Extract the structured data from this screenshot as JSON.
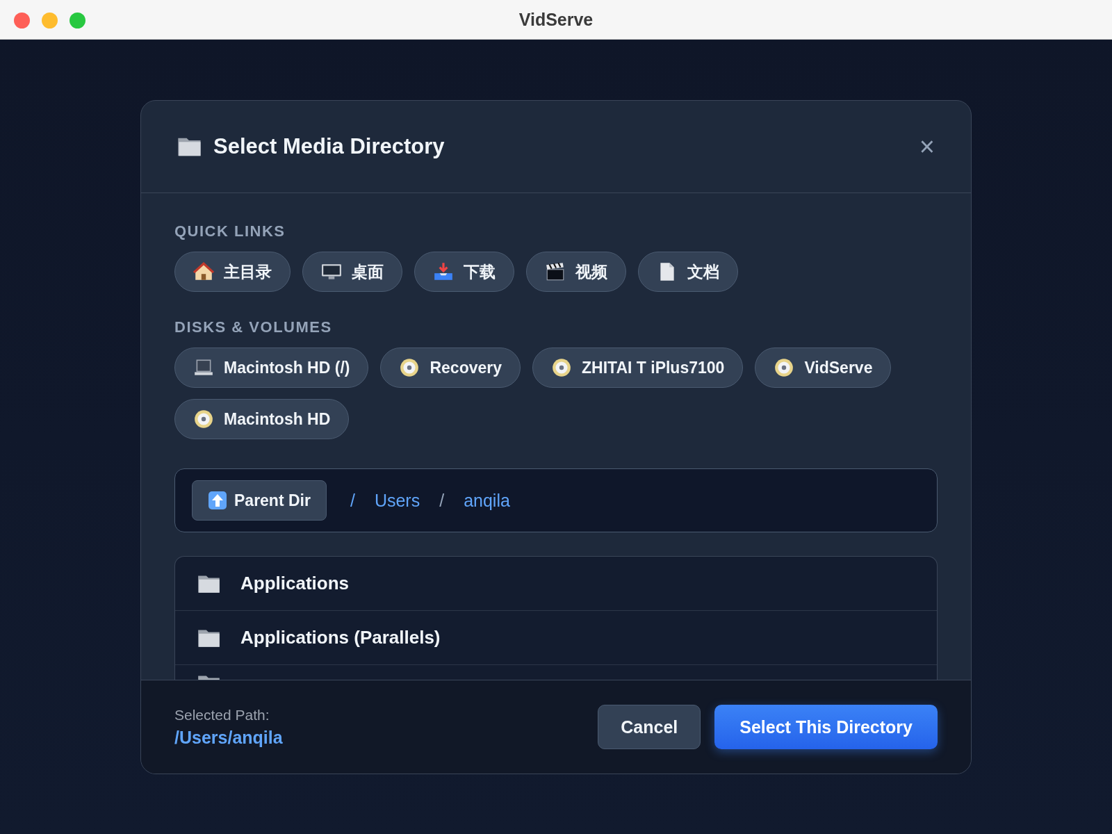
{
  "window": {
    "title": "VidServe"
  },
  "dialog": {
    "title": "Select Media Directory",
    "close": "×"
  },
  "quick_links": {
    "heading": "QUICK LINKS",
    "items": [
      {
        "kind": "home",
        "label": "主目录"
      },
      {
        "kind": "desktop",
        "label": "桌面"
      },
      {
        "kind": "download",
        "label": "下载"
      },
      {
        "kind": "video",
        "label": "视频"
      },
      {
        "kind": "document",
        "label": "文档"
      }
    ]
  },
  "disks": {
    "heading": "DISKS & VOLUMES",
    "items": [
      {
        "kind": "laptop",
        "label": "Macintosh HD (/)"
      },
      {
        "kind": "disc",
        "label": "Recovery"
      },
      {
        "kind": "disc",
        "label": "ZHITAI T iPlus7100"
      },
      {
        "kind": "disc",
        "label": "VidServe"
      },
      {
        "kind": "disc",
        "label": "Macintosh HD"
      }
    ]
  },
  "path_bar": {
    "parent_button": "Parent Dir",
    "crumbs": [
      "/",
      "Users",
      "/",
      "anqila"
    ]
  },
  "folders": [
    {
      "name": "Applications"
    },
    {
      "name": "Applications (Parallels)"
    }
  ],
  "footer": {
    "label": "Selected Path:",
    "path": "/Users/anqila",
    "buttons": [
      {
        "kind": "secondary",
        "label": "Cancel"
      },
      {
        "kind": "primary",
        "label": "Select This Directory"
      }
    ]
  }
}
